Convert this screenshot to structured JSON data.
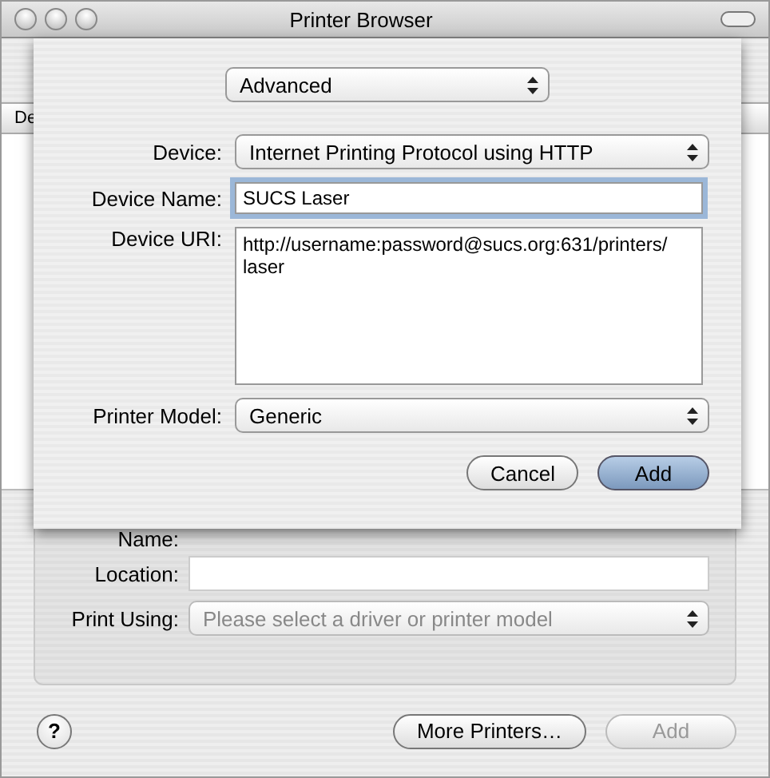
{
  "window": {
    "title": "Printer Browser"
  },
  "list": {
    "column_1": "De"
  },
  "details": {
    "name_label": "Name:",
    "location": {
      "label": "Location:"
    },
    "print_using": {
      "label": "Print Using:",
      "value": "Please select a driver or printer model",
      "disabled": true
    }
  },
  "footer": {
    "help": "?",
    "more_printers": {
      "label": "More Printers…",
      "disabled": false
    },
    "add": {
      "label": "Add",
      "disabled": true
    }
  },
  "sheet": {
    "mode": {
      "value": "Advanced"
    },
    "device": {
      "label": "Device:",
      "value": "Internet Printing Protocol using HTTP"
    },
    "device_name": {
      "label": "Device Name:",
      "value": "SUCS Laser",
      "focused": true
    },
    "device_uri": {
      "label": "Device URI:",
      "value": "http://username:password@sucs.org:631/printers/laser"
    },
    "printer_model": {
      "label": "Printer Model:",
      "value": "Generic"
    },
    "buttons": [
      {
        "label": "Cancel",
        "default": false
      },
      {
        "label": "Add",
        "default": true
      }
    ]
  }
}
